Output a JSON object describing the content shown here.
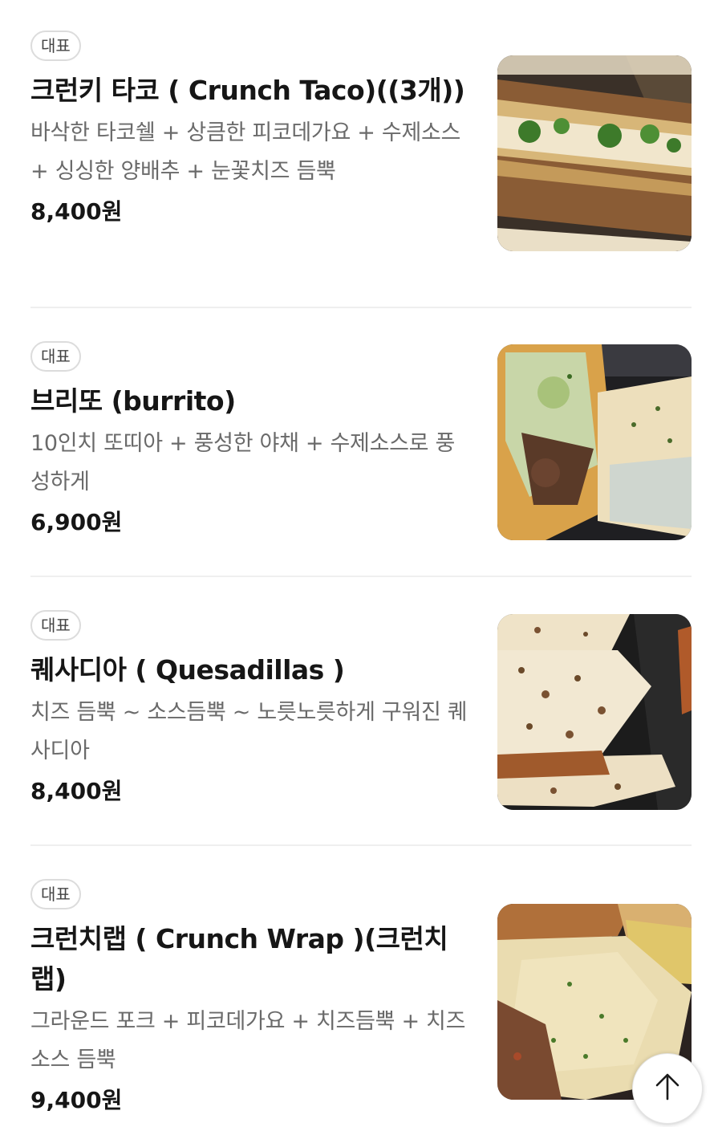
{
  "menu": {
    "items": [
      {
        "badge": "대표",
        "name": "크런키 타코 ( Crunch Taco)((3개))",
        "description": "바삭한 타코쉘 + 상큼한 피코데가요 + 수제소스 + 싱싱한 양배추 + 눈꽃치즈 듬뿍",
        "price": "8,400원",
        "image": "taco-photo"
      },
      {
        "badge": "대표",
        "name": "브리또 (burrito)",
        "description": "10인치 또띠아 + 풍성한 야채 + 수제소스로 풍성하게",
        "price": "6,900원",
        "image": "burrito-photo"
      },
      {
        "badge": "대표",
        "name": "퀘사디아 ( Quesadillas )",
        "description": "치즈 듬뿍 ~ 소스듬뿍 ~ 노릇노릇하게 구워진 퀘사디아",
        "price": "8,400원",
        "image": "quesadilla-photo"
      },
      {
        "badge": "대표",
        "name": "크런치랩 ( Crunch Wrap )(크런치랩)",
        "description": "그라운드 포크 + 피코데가요 + 치즈듬뿍 + 치즈소스 듬뿍",
        "price": "9,400원",
        "image": "crunchwrap-photo"
      }
    ]
  },
  "scroll_top_button": {
    "icon": "arrow-up-icon"
  },
  "colors": {
    "text_primary": "#161616",
    "text_secondary": "#6a6a6a",
    "badge_border": "#dcdcdc",
    "divider": "#efefef"
  }
}
